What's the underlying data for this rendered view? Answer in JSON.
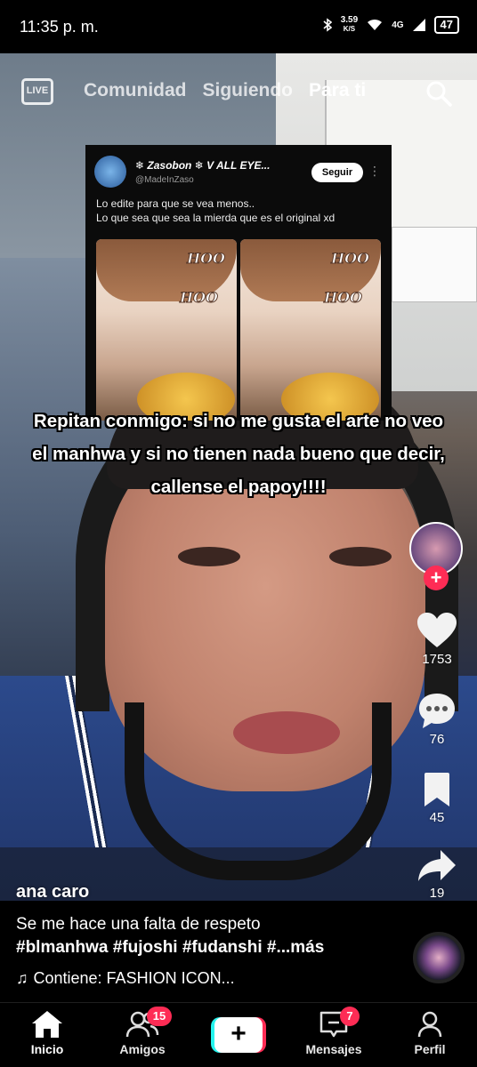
{
  "status_bar": {
    "time": "11:35 p. m.",
    "net_speed_value": "3.59",
    "net_speed_unit": "K/S",
    "network": "4G",
    "battery": "47"
  },
  "top_nav": {
    "live_label": "LIVE",
    "tabs": [
      "Comunidad",
      "Siguiendo",
      "Para ti"
    ],
    "active_tab": "Para ti"
  },
  "embedded_post": {
    "display_name": "❄ Zasobon ❄ V ALL EYE...",
    "handle": "@MadeInZaso",
    "follow_label": "Seguir",
    "text": "Lo edite para que se vea menos..\n Lo que sea que sea la mierda que es el original xd",
    "sfx": [
      "HOO",
      "HOO"
    ]
  },
  "caption": "Repitan conmigo: si no me gusta el arte no veo el manhwa y si no tienen nada bueno que decir, callense el papoy!!!!",
  "actions": {
    "likes": "1753",
    "comments": "76",
    "saves": "45",
    "shares": "19"
  },
  "post": {
    "author": "ana caro",
    "description": "Se me hace una falta de respeto",
    "hashtags": "#blmanhwa #fujoshi #fudanshi #...más",
    "music": "Contiene: FASHION ICON..."
  },
  "bottom_nav": {
    "home": "Inicio",
    "friends": "Amigos",
    "friends_badge": "15",
    "create": "+",
    "inbox": "Mensajes",
    "inbox_badge": "7",
    "profile": "Perfil"
  },
  "colors": {
    "accent_red": "#fe2c55",
    "accent_cyan": "#25f4ee",
    "background": "#000000"
  }
}
